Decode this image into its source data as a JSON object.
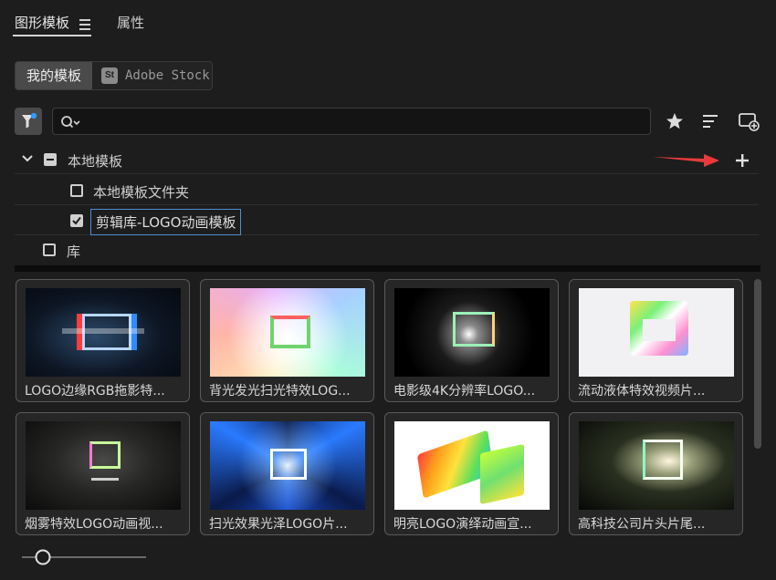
{
  "header": {
    "tab_active": "图形模板",
    "tab_other": "属性"
  },
  "source_selector": {
    "my_templates": "我的模板",
    "stock_badge": "St",
    "stock_label": "Adobe Stock"
  },
  "search": {
    "value": "",
    "placeholder": ""
  },
  "tree": {
    "local_templates": "本地模板",
    "local_folder": "本地模板文件夹",
    "jianji_library": "剪辑库-LOGO动画模板",
    "library": "库"
  },
  "templates": [
    {
      "label": "LOGO边缘RGB拖影特..."
    },
    {
      "label": "背光发光扫光特效LOG..."
    },
    {
      "label": "电影级4K分辨率LOGO..."
    },
    {
      "label": "流动液体特效视频片..."
    },
    {
      "label": "烟雾特效LOGO动画视..."
    },
    {
      "label": "扫光效果光泽LOGO片..."
    },
    {
      "label": "明亮LOGO演绎动画宣..."
    },
    {
      "label": "高科技公司片头片尾..."
    }
  ],
  "colors": {
    "background": "#1d1d1d",
    "selection_outline": "#4f8ecf",
    "annotation_arrow": "#e83a3a",
    "filter_dot": "#2d9cff"
  },
  "icons": [
    "menu-icon",
    "stock-icon",
    "filter-icon",
    "search-icon",
    "star-icon",
    "sort-icon",
    "new-folder-icon",
    "chevron-down-icon",
    "plus-icon",
    "checkbox-icon"
  ]
}
